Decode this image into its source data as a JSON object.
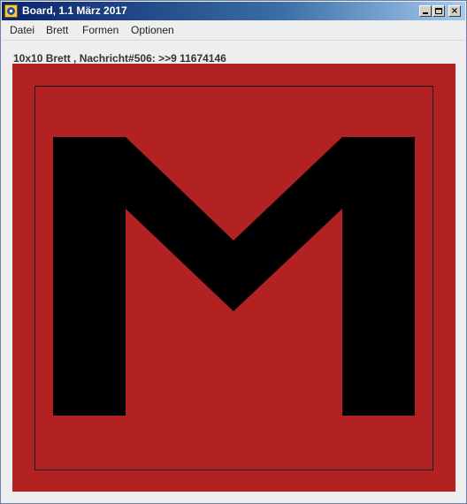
{
  "window": {
    "title": "Board, 1.1 März 2017",
    "app_icon": "board-app-icon",
    "controls": {
      "minimize_icon": "minimize-icon",
      "maximize_icon": "maximize-icon",
      "close_icon": "close-icon",
      "close_glyph": "×"
    }
  },
  "menu": {
    "items": [
      {
        "label": "Datei"
      },
      {
        "label": "Brett"
      },
      {
        "label": "Formen"
      },
      {
        "label": "Optionen"
      }
    ]
  },
  "status": {
    "text": "10x10 Brett , Nachricht#506: >>9 11674146"
  },
  "board": {
    "background_color": "#b22222",
    "shape_color": "#000000",
    "frame_color": "#1a1a1a",
    "shape": "letter-M"
  }
}
